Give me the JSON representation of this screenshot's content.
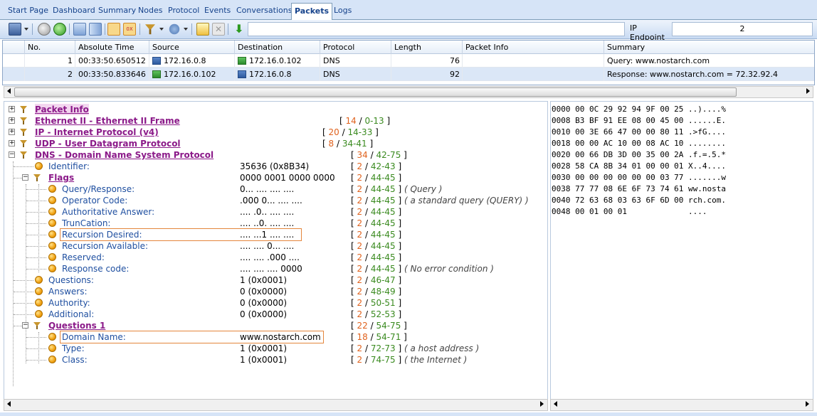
{
  "tabs": [
    {
      "label": "Start Page"
    },
    {
      "label": "Dashboard"
    },
    {
      "label": "Summary"
    },
    {
      "label": "Nodes"
    },
    {
      "label": "Protocol"
    },
    {
      "label": "Events"
    },
    {
      "label": "Conversations"
    },
    {
      "label": "Packets"
    },
    {
      "label": "Logs"
    }
  ],
  "toolbar": {
    "ip_endpoint_label": "IP Endpoint",
    "ip_endpoint_value": "2",
    "icons": [
      "save-icon",
      "back-icon",
      "forward-icon",
      "pane-horizontal-icon",
      "pane-vertical-icon",
      "tree-view-icon",
      "hex-view-icon",
      "filter-icon",
      "color-rules-icon",
      "edit-icon",
      "delete-icon",
      "download-icon"
    ]
  },
  "grid": {
    "columns": [
      "No.",
      "Absolute Time",
      "Source",
      "Destination",
      "Protocol",
      "Length",
      "Packet Info",
      "Summary"
    ],
    "rows": [
      {
        "no": "1",
        "time": "00:33:50.650512",
        "src": "172.16.0.8",
        "dst": "172.16.0.102",
        "proto": "DNS",
        "len": "76",
        "info": "",
        "summary": "Query: www.nostarch.com"
      },
      {
        "no": "2",
        "time": "00:33:50.833646",
        "src": "172.16.0.102",
        "dst": "172.16.0.8",
        "proto": "DNS",
        "len": "92",
        "info": "",
        "summary": "Response: www.nostarch.com = 72.32.92.4"
      }
    ]
  },
  "tree": {
    "headers": [
      {
        "label": "Packet Info",
        "len": "",
        "range": ""
      },
      {
        "label": "Ethernet II - Ethernet II Frame",
        "len": "14",
        "range": "0-13"
      },
      {
        "label": "IP - Internet Protocol (v4)",
        "len": "20",
        "range": "14-33"
      },
      {
        "label": "UDP - User Datagram Protocol",
        "len": "8",
        "range": "34-41"
      },
      {
        "label": "DNS - Domain Name System Protocol",
        "len": "34",
        "range": "42-75"
      }
    ],
    "fields": [
      {
        "label": "Identifier:",
        "value": "35636 (0x8B34)",
        "len": "2",
        "range": "42-43",
        "desc": ""
      },
      {
        "label": "Flags",
        "value": "0000 0001 0000 0000",
        "len": "2",
        "range": "44-45",
        "desc": ""
      },
      {
        "label": "Query/Response:",
        "value": "0... .... .... ....",
        "len": "2",
        "range": "44-45",
        "desc": "( Query )"
      },
      {
        "label": "Operator Code:",
        "value": ".000 0... .... ....",
        "len": "2",
        "range": "44-45",
        "desc": "( a standard query (QUERY) )"
      },
      {
        "label": "Authoritative Answer:",
        "value": ".... .0.. .... ....",
        "len": "2",
        "range": "44-45",
        "desc": ""
      },
      {
        "label": "TrunCation:",
        "value": ".... ..0. .... ....",
        "len": "2",
        "range": "44-45",
        "desc": ""
      },
      {
        "label": "Recursion Desired:",
        "value": ".... ...1 .... ....",
        "len": "2",
        "range": "44-45",
        "desc": ""
      },
      {
        "label": "Recursion Available:",
        "value": ".... .... 0... ....",
        "len": "2",
        "range": "44-45",
        "desc": ""
      },
      {
        "label": "Reserved:",
        "value": ".... .... .000 ....",
        "len": "2",
        "range": "44-45",
        "desc": ""
      },
      {
        "label": "Response code:",
        "value": ".... .... .... 0000",
        "len": "2",
        "range": "44-45",
        "desc": "( No error condition )"
      },
      {
        "label": "Questions:",
        "value": "1 (0x0001)",
        "len": "2",
        "range": "46-47",
        "desc": ""
      },
      {
        "label": "Answers:",
        "value": "0 (0x0000)",
        "len": "2",
        "range": "48-49",
        "desc": ""
      },
      {
        "label": "Authority:",
        "value": "0 (0x0000)",
        "len": "2",
        "range": "50-51",
        "desc": ""
      },
      {
        "label": "Additional:",
        "value": "0 (0x0000)",
        "len": "2",
        "range": "52-53",
        "desc": ""
      },
      {
        "label": "Questions 1",
        "value": "",
        "len": "22",
        "range": "54-75",
        "desc": ""
      },
      {
        "label": "Domain Name:",
        "value": "www.nostarch.com",
        "len": "18",
        "range": "54-71",
        "desc": ""
      },
      {
        "label": "Type:",
        "value": "1 (0x0001)",
        "len": "2",
        "range": "72-73",
        "desc": "( a host address )"
      },
      {
        "label": "Class:",
        "value": "1 (0x0001)",
        "len": "2",
        "range": "74-75",
        "desc": "( the Internet )"
      }
    ]
  },
  "hex": [
    "0000 00 0C 29 92 94 9F 00 25 ..)....%",
    "0008 B3 BF 91 EE 08 00 45 00 ......E.",
    "0010 00 3E 66 47 00 00 80 11 .>fG....",
    "0018 00 00 AC 10 00 08 AC 10 ........",
    "0020 00 66 DB 3D 00 35 00 2A .f.=.5.*",
    "0028 58 CA 8B 34 01 00 00 01 X..4....",
    "0030 00 00 00 00 00 00 03 77 .......w",
    "0038 77 77 08 6E 6F 73 74 61 ww.nosta",
    "0040 72 63 68 03 63 6F 6D 00 rch.com.",
    "0048 00 01 00 01             ...."
  ],
  "colors": {
    "header_text": "#8b1a89",
    "field_text": "#1f4fa0",
    "len_color": "#e0621d",
    "range_color": "#3a8a1f",
    "highlight": "#e4863c"
  }
}
